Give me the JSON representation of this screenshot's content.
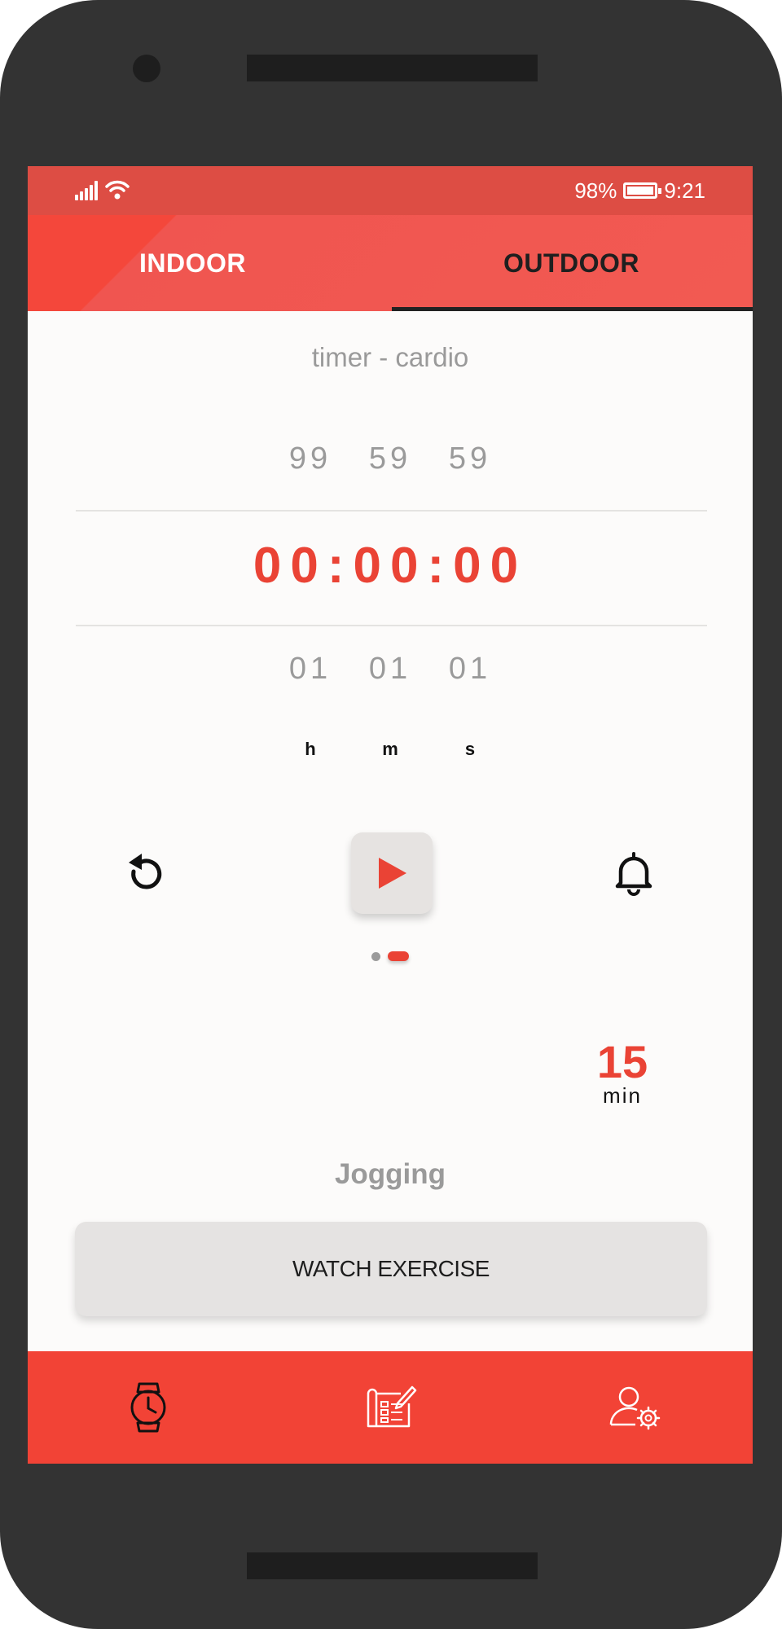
{
  "status_bar": {
    "battery_percent": "98%",
    "battery_level": 0.98,
    "time": "9:21",
    "icons": [
      "signal-icon",
      "wifi-icon",
      "battery-icon"
    ]
  },
  "tabs": [
    {
      "label": "INDOOR",
      "active": false
    },
    {
      "label": "OUTDOOR",
      "active": true
    }
  ],
  "timer": {
    "subtitle": "timer - cardio",
    "above": [
      "99",
      "59",
      "59"
    ],
    "current": "00:00:00",
    "below": [
      "01",
      "01",
      "01"
    ],
    "units": [
      "h",
      "m",
      "s"
    ]
  },
  "controls": {
    "restart_icon": "restart-icon",
    "play_icon": "play-icon",
    "bell_icon": "bell-icon"
  },
  "pager": {
    "count": 2,
    "active_index": 1
  },
  "duration": {
    "value": "15",
    "unit": "min"
  },
  "exercise": {
    "name": "Jogging",
    "watch_label": "WATCH EXERCISE"
  },
  "bottom_nav": [
    {
      "icon": "watch-icon"
    },
    {
      "icon": "workout-plan-icon"
    },
    {
      "icon": "user-settings-icon"
    }
  ],
  "colors": {
    "accent": "#ea4335",
    "header": "#f25a52",
    "nav": "#f24336",
    "phone_frame": "#333333"
  }
}
